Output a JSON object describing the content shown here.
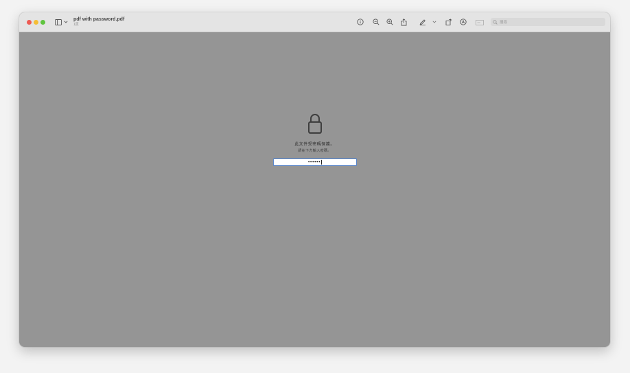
{
  "window": {
    "title": "pdf with password.pdf",
    "subtitle": "1頁"
  },
  "toolbar": {
    "icons": [
      "sidebar-icon",
      "chevron-down-icon",
      "info-icon",
      "zoom-out-icon",
      "zoom-in-icon",
      "share-icon",
      "markup-pen-icon",
      "chevron-down-icon",
      "rotate-icon",
      "annotate-icon",
      "form-icon",
      "search-icon"
    ],
    "search_placeholder": "搜尋"
  },
  "locked": {
    "message": "此文件受密碼保護。",
    "instruction": "請在下方輸入密碼。",
    "password_mask": "••••••"
  },
  "colors": {
    "background": "#959595",
    "toolbar": "#e4e4e4",
    "field_border": "#5b86c9"
  }
}
